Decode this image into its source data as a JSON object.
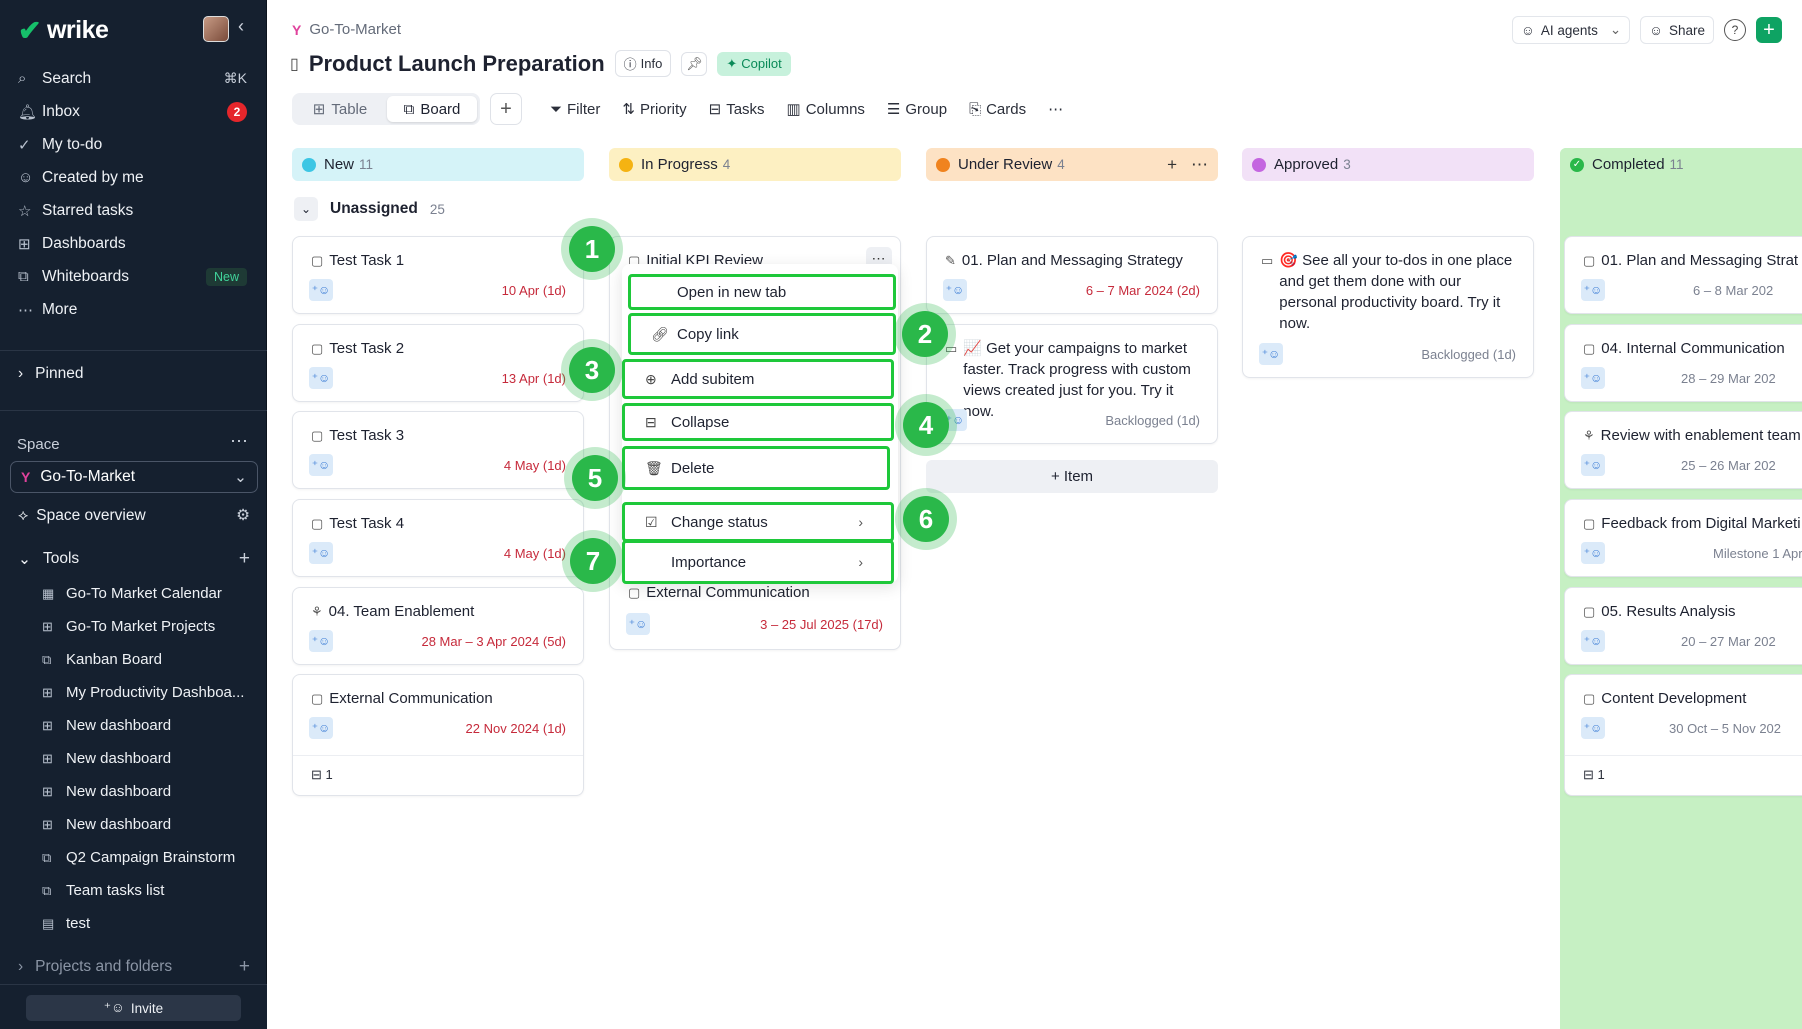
{
  "sidebar": {
    "brand": "wrike",
    "nav": [
      {
        "icon": "search-icon",
        "label": "Search",
        "shortcut": "⌘K"
      },
      {
        "icon": "bell-icon",
        "label": "Inbox",
        "badge": "2"
      },
      {
        "icon": "check-icon",
        "label": "My to-do"
      },
      {
        "icon": "user-icon",
        "label": "Created by me"
      },
      {
        "icon": "star-icon",
        "label": "Starred tasks"
      },
      {
        "icon": "dashboard-icon",
        "label": "Dashboards"
      },
      {
        "icon": "whiteboard-icon",
        "label": "Whiteboards",
        "badge": "New"
      },
      {
        "icon": "dots-icon",
        "label": "More"
      }
    ],
    "pinned": "Pinned",
    "space_label": "Space",
    "space_name": "Go-To-Market",
    "space_overview": "Space overview",
    "tools_label": "Tools",
    "tools": [
      "Go-To Market Calendar",
      "Go-To Market Projects",
      "Kanban Board",
      "My Productivity Dashboa...",
      "New dashboard",
      "New dashboard",
      "New dashboard",
      "New dashboard",
      "Q2 Campaign Brainstorm",
      "Team tasks list",
      "test"
    ],
    "projects": "Projects and folders",
    "invite": "Invite"
  },
  "header": {
    "breadcrumb": "Go-To-Market",
    "title": "Product Launch Preparation",
    "info": "Info",
    "copilot": "Copilot",
    "ai_agents": "AI agents",
    "share": "Share"
  },
  "views": {
    "table": "Table",
    "board": "Board"
  },
  "toolbar": [
    "Filter",
    "Priority",
    "Tasks",
    "Columns",
    "Group",
    "Cards"
  ],
  "columns": [
    {
      "name": "New",
      "count": "11",
      "color": "#d5f3f8",
      "dot": "#3cc6e4"
    },
    {
      "name": "In Progress",
      "count": "4",
      "color": "#fdf0c2",
      "dot": "#f5b312"
    },
    {
      "name": "Under Review",
      "count": "4",
      "color": "#fde2c4",
      "dot": "#f0831e"
    },
    {
      "name": "Approved",
      "count": "3",
      "color": "#f2e1f7",
      "dot": "#c466e0"
    },
    {
      "name": "Completed",
      "count": "11",
      "color": "#c6f0c3",
      "dot": "#2ab84a"
    }
  ],
  "group": {
    "name": "Unassigned",
    "count": "25"
  },
  "cards": {
    "new": [
      {
        "title": "Test Task 1",
        "date": "10 Apr (1d)"
      },
      {
        "title": "Test Task 2",
        "date": "13 Apr (1d)"
      },
      {
        "title": "Test Task 3",
        "date": "4 May (1d)"
      },
      {
        "title": "Test Task 4",
        "date": "4 May (1d)"
      },
      {
        "title": "04. Team Enablement",
        "date": "28 Mar – 3 Apr 2024 (5d)"
      },
      {
        "title": "External Communication",
        "date": "22 Nov 2024 (1d)",
        "subitems": "1"
      }
    ],
    "in_progress": [
      {
        "title": "Initial KPI Review"
      },
      {
        "title": "External Communication",
        "date": "3 – 25 Jul 2025 (17d)"
      }
    ],
    "under_review": [
      {
        "title": "01. Plan and Messaging Strategy",
        "date": "6 – 7 Mar 2024 (2d)"
      },
      {
        "title": "📈 Get your campaigns to market faster. Track progress with custom views created just for you. Try it now.",
        "date": "Backlogged (1d)"
      }
    ],
    "approved": [
      {
        "title": "🎯 See all your to-dos in one place and get them done with our personal productivity board. Try it now.",
        "date": "Backlogged (1d)"
      }
    ],
    "completed": [
      {
        "title": "01. Plan and Messaging Strat",
        "date": "6 – 8 Mar 202"
      },
      {
        "title": "04. Internal Communication",
        "date": "28 – 29 Mar 202"
      },
      {
        "title": "Review with enablement team",
        "date": "25 – 26 Mar 202"
      },
      {
        "title": "Feedback from Digital Marketi",
        "date": "Milestone 1 Apr"
      },
      {
        "title": "05. Results Analysis",
        "date": "20 – 27 Mar 202"
      },
      {
        "title": "Content Development",
        "date": "30 Oct – 5 Nov 202",
        "subitems": "1"
      }
    ]
  },
  "add_item": "+ Item",
  "context_menu": {
    "open_new_tab": "Open in new tab",
    "copy_link": "Copy link",
    "add_subitem": "Add subitem",
    "collapse": "Collapse",
    "delete": "Delete",
    "change_status": "Change status",
    "importance": "Importance"
  },
  "markers": [
    "1",
    "2",
    "3",
    "4",
    "5",
    "6",
    "7"
  ]
}
